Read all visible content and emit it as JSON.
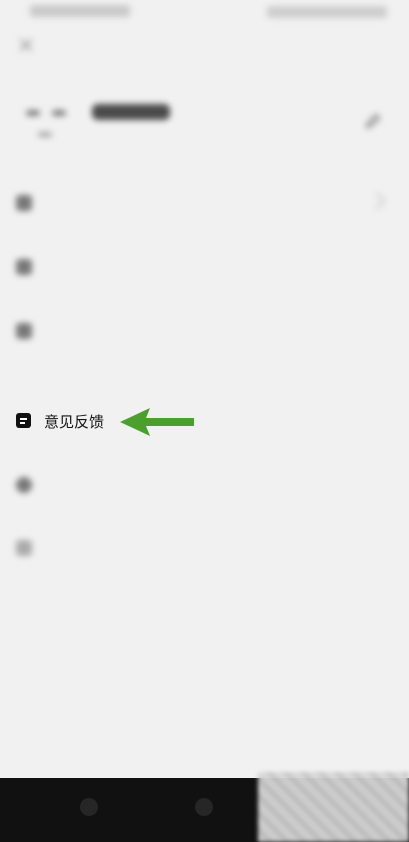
{
  "status_bar": {
    "left_text": "",
    "right_text": ""
  },
  "profile": {
    "name": "",
    "id": ""
  },
  "menu": {
    "items": [
      {
        "id": "item1",
        "label": ""
      },
      {
        "id": "item2",
        "label": ""
      },
      {
        "id": "item3",
        "label": ""
      },
      {
        "id": "feedback",
        "label": "意见反馈"
      },
      {
        "id": "item5",
        "label": ""
      },
      {
        "id": "item6",
        "label": ""
      }
    ]
  },
  "colors": {
    "arrow": "#4aa02c",
    "text": "#111111",
    "background": "#f1f1f1"
  }
}
